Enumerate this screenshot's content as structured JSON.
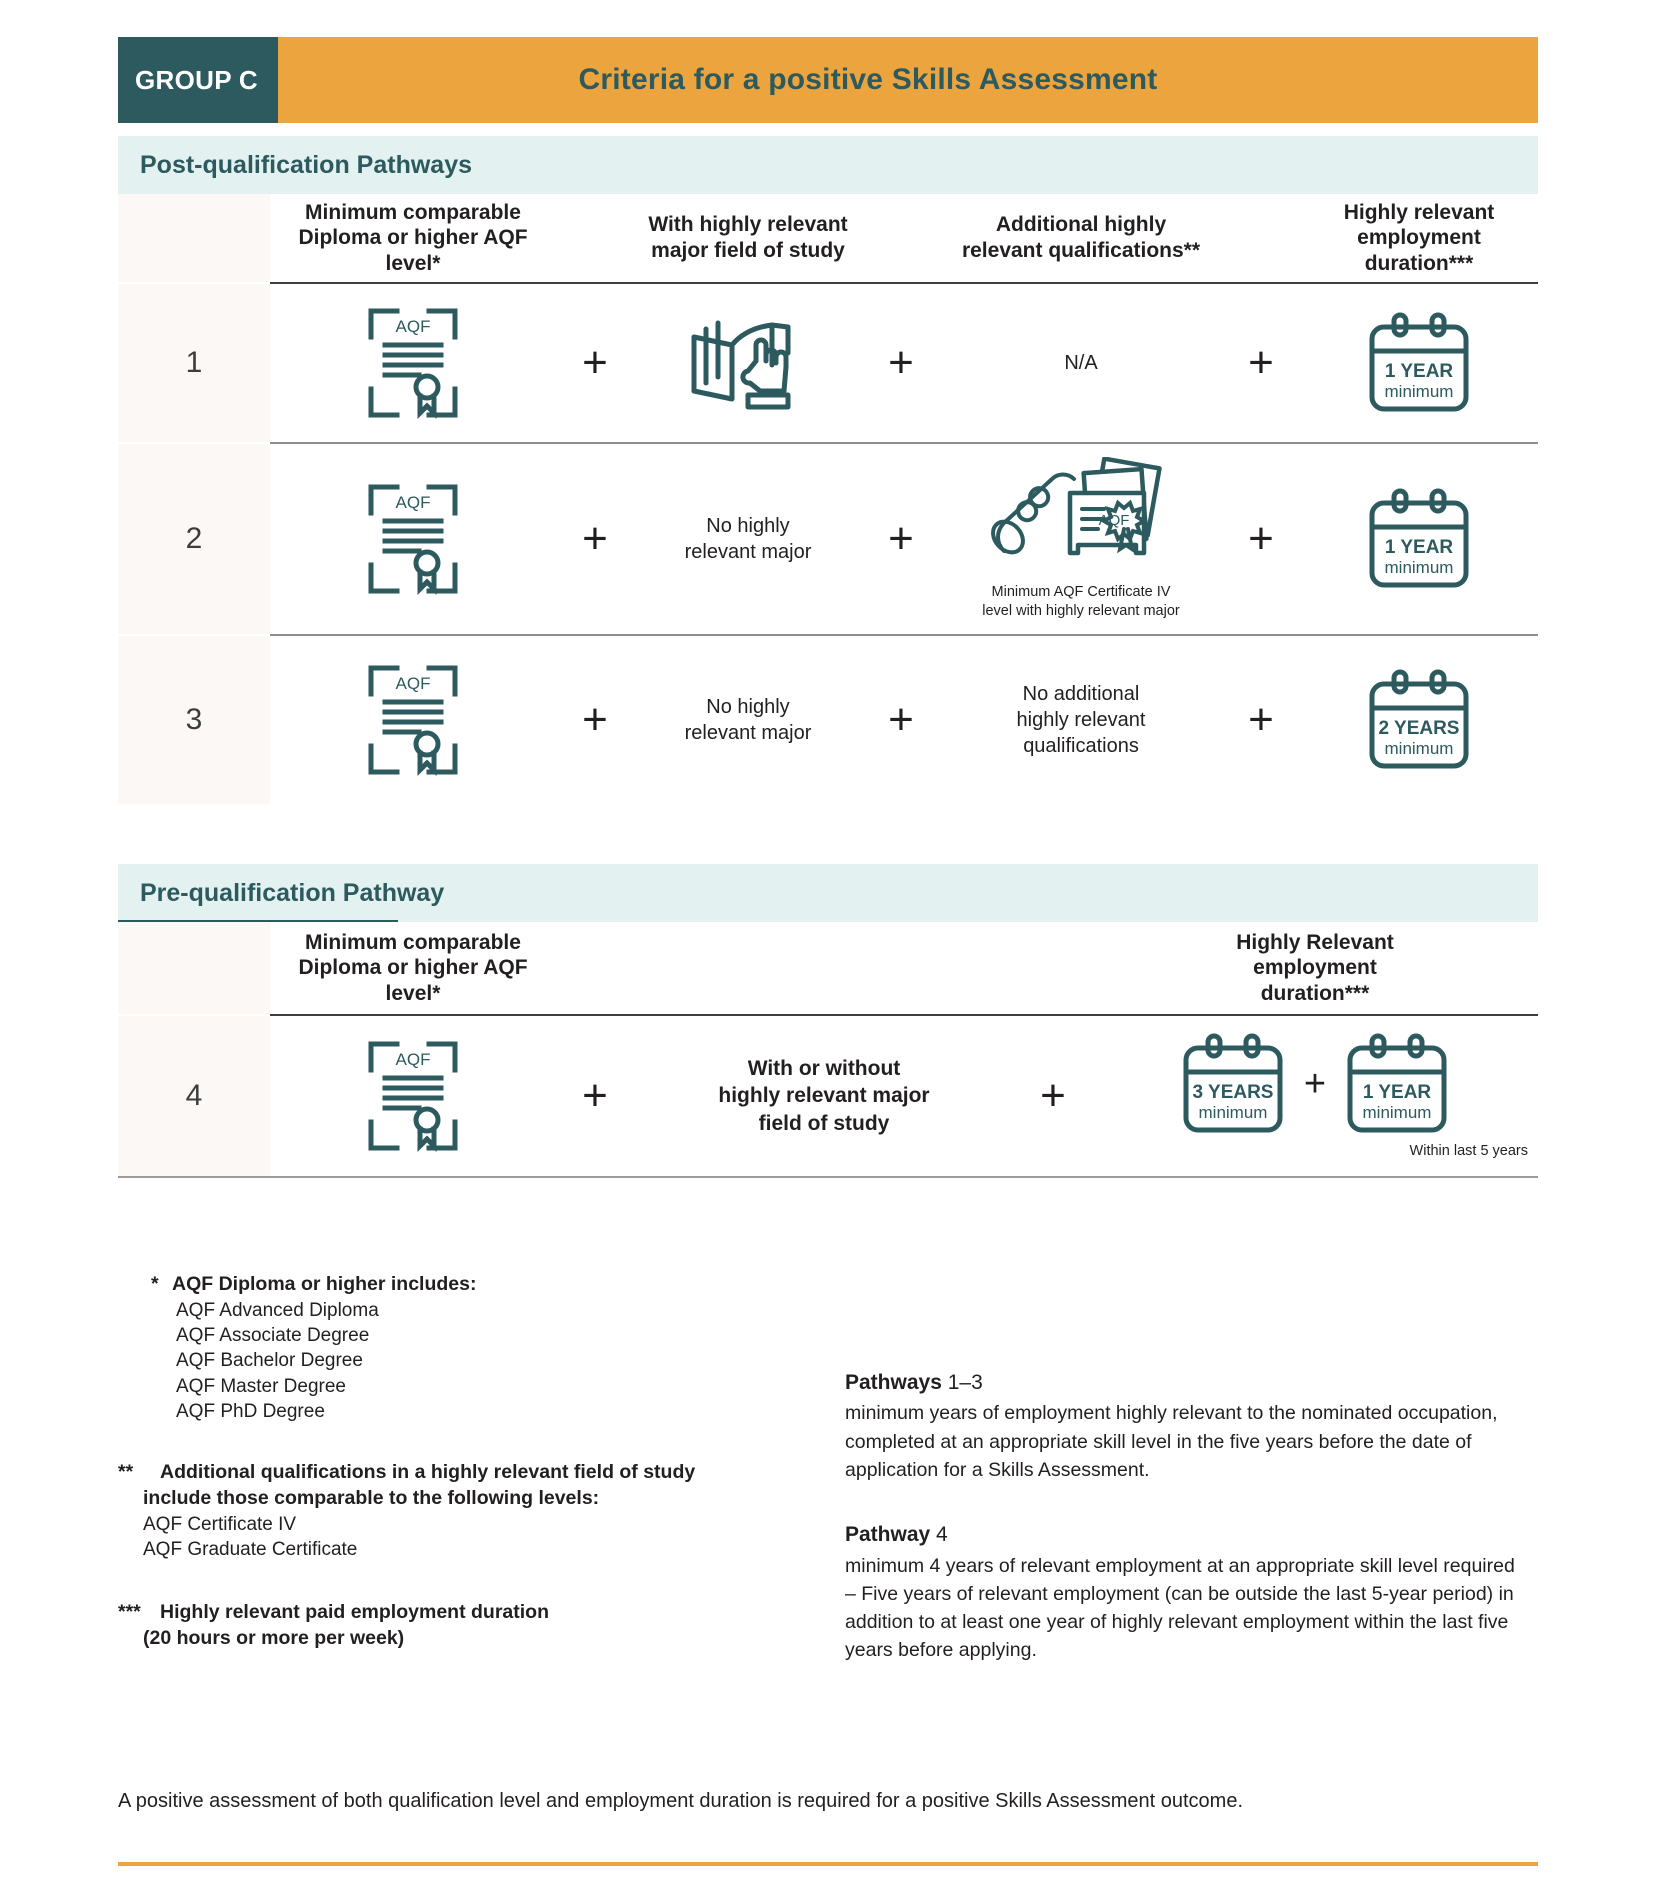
{
  "header": {
    "group_label": "GROUP C",
    "title": "Criteria for a positive Skills Assessment",
    "accent_orange": "#eca53e",
    "accent_teal": "#2c5a5e"
  },
  "sections": {
    "post": {
      "banner": "Post-qualification Pathways",
      "columns": [
        "Minimum  comparable Diploma or higher AQF level*",
        "With highly relevant major field of study",
        "Additional highly relevant qualifications**",
        "Highly relevant employment duration***"
      ],
      "column_lines": [
        [
          "Minimum  comparable",
          "Diploma or higher AQF",
          "level*"
        ],
        [
          "With highly relevant",
          "major field of study"
        ],
        [
          "Additional highly",
          "relevant qualifications**"
        ],
        [
          "Highly relevant",
          "employment",
          "duration***"
        ]
      ],
      "rows": [
        {
          "number": "1",
          "qualification_icon": "aqf-certificate-icon",
          "major_field": {
            "type": "icon",
            "icon": "open-book-hand-icon",
            "lines": []
          },
          "additional_quals": {
            "type": "text",
            "lines": [
              "N/A"
            ],
            "caption": ""
          },
          "duration": {
            "icon": "calendar-icon",
            "value": "1 YEAR",
            "unit": "minimum"
          }
        },
        {
          "number": "2",
          "qualification_icon": "aqf-certificate-icon",
          "major_field": {
            "type": "text",
            "lines": [
              "No highly",
              "relevant major"
            ]
          },
          "additional_quals": {
            "type": "icon",
            "icon": "diploma-scroll-certificates-icon",
            "caption_lines": [
              "Minimum AQF Certificate IV",
              "level with highly relevant major"
            ]
          },
          "duration": {
            "icon": "calendar-icon",
            "value": "1 YEAR",
            "unit": "minimum"
          }
        },
        {
          "number": "3",
          "qualification_icon": "aqf-certificate-icon",
          "major_field": {
            "type": "text",
            "lines": [
              "No highly",
              "relevant major"
            ]
          },
          "additional_quals": {
            "type": "text",
            "lines": [
              "No additional",
              "highly relevant",
              "qualifications"
            ],
            "caption": ""
          },
          "duration": {
            "icon": "calendar-icon",
            "value": "2 YEARS",
            "unit": "minimum"
          }
        }
      ]
    },
    "pre": {
      "banner": "Pre-qualification Pathway",
      "column_lines": [
        [
          "Minimum  comparable",
          "Diploma  or higher AQF",
          "level*"
        ],
        [
          "Highly Relevant",
          "employment",
          "duration***"
        ]
      ],
      "row": {
        "number": "4",
        "qualification_icon": "aqf-certificate-icon",
        "major_field_lines": [
          "With or without",
          "highly relevant major",
          "field of study"
        ],
        "durations": [
          {
            "icon": "calendar-icon",
            "value": "3 YEARS",
            "unit": "minimum"
          },
          {
            "icon": "calendar-icon",
            "value": "1 YEAR",
            "unit": "minimum"
          }
        ],
        "duration_note": "Within last 5 years"
      }
    }
  },
  "plus_symbol": "+",
  "certificate_icon_label": "AQF",
  "footnotes": {
    "single_star": {
      "marker": "*",
      "lead_bold": "AQF Diploma",
      "lead_rest": " or higher includes:",
      "items": [
        "AQF Advanced Diploma",
        "AQF Associate Degree",
        "AQF Bachelor Degree",
        "AQF Master Degree",
        "AQF PhD Degree"
      ]
    },
    "double_star": {
      "marker": "**",
      "lead_line1": "Additional qualifications in a highly relevant field of study",
      "lead_line2": "include those comparable to the following levels:",
      "items": [
        "AQF Certificate IV",
        "AQF Graduate Certificate"
      ]
    },
    "triple_star": {
      "marker": "***",
      "line1": "Highly relevant paid employment duration",
      "line2": "(20 hours or more per week)"
    }
  },
  "pathway_notes": [
    {
      "title_bold": "Pathways",
      "title_rest": " 1–3",
      "body": "minimum years of employment highly relevant to the nominated occupation, completed at an appropriate skill level in the five years before the date of application for a Skills Assessment."
    },
    {
      "title_bold": "Pathway",
      "title_rest": " 4",
      "body": "minimum 4 years of relevant employment at an appropriate skill level required – Five years of  relevant employment (can be outside the last 5-year period) in addition to at least one year of highly relevant employment within the last five years before applying."
    }
  ],
  "closing_statement": "A positive assessment of both qualification level and employment duration is required for a positive Skills Assessment outcome."
}
